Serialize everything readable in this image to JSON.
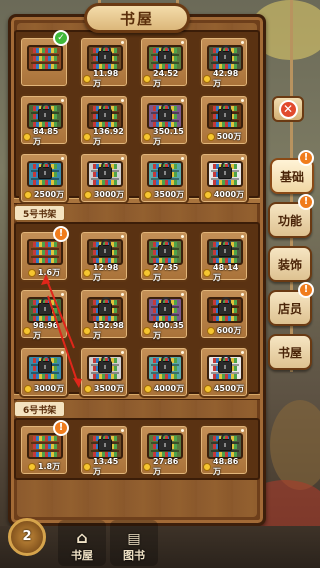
{
  "title": "书屋",
  "sections": [
    {
      "label": "",
      "items": [
        {
          "price": "",
          "locked": false,
          "owned": true,
          "alert": false,
          "color": "#8a4a24"
        },
        {
          "price": "11.98万",
          "locked": true,
          "owned": false,
          "alert": false,
          "color": "#6b4a26"
        },
        {
          "price": "24.52万",
          "locked": true,
          "owned": false,
          "alert": false,
          "color": "#5a7a3e"
        },
        {
          "price": "42.98万",
          "locked": true,
          "owned": false,
          "alert": false,
          "color": "#4e5a42"
        },
        {
          "price": "84.85万",
          "locked": true,
          "owned": false,
          "alert": false,
          "color": "#4a6a3a"
        },
        {
          "price": "136.92万",
          "locked": true,
          "owned": false,
          "alert": false,
          "color": "#6a4020"
        },
        {
          "price": "350.15万",
          "locked": true,
          "owned": false,
          "alert": false,
          "color": "#7a5a8a"
        },
        {
          "price": "500万",
          "locked": true,
          "owned": false,
          "alert": false,
          "color": "#6a3a18"
        },
        {
          "price": "2500万",
          "locked": true,
          "owned": false,
          "alert": false,
          "color": "#3a8aa8"
        },
        {
          "price": "3000万",
          "locked": true,
          "owned": false,
          "alert": false,
          "color": "#cfcfcf"
        },
        {
          "price": "3500万",
          "locked": true,
          "owned": false,
          "alert": false,
          "color": "#5aa8a8"
        },
        {
          "price": "4000万",
          "locked": true,
          "owned": false,
          "alert": false,
          "color": "#e8e8e8"
        }
      ]
    },
    {
      "label": "5号书架",
      "items": [
        {
          "price": "1.6万",
          "locked": false,
          "owned": false,
          "alert": true,
          "color": "#8a4a24"
        },
        {
          "price": "12.98万",
          "locked": true,
          "owned": false,
          "alert": false,
          "color": "#6b4a26"
        },
        {
          "price": "27.35万",
          "locked": true,
          "owned": false,
          "alert": false,
          "color": "#5a7a3e"
        },
        {
          "price": "48.14万",
          "locked": true,
          "owned": false,
          "alert": false,
          "color": "#4e5a42"
        },
        {
          "price": "98.96万",
          "locked": true,
          "owned": false,
          "alert": false,
          "color": "#4a6a3a"
        },
        {
          "price": "152.98万",
          "locked": true,
          "owned": false,
          "alert": false,
          "color": "#6a4020"
        },
        {
          "price": "400.35万",
          "locked": true,
          "owned": false,
          "alert": false,
          "color": "#7a5a8a"
        },
        {
          "price": "600万",
          "locked": true,
          "owned": false,
          "alert": false,
          "color": "#6a3a18"
        },
        {
          "price": "3000万",
          "locked": true,
          "owned": false,
          "alert": false,
          "color": "#3a8aa8"
        },
        {
          "price": "3500万",
          "locked": true,
          "owned": false,
          "alert": false,
          "color": "#cfcfcf"
        },
        {
          "price": "4000万",
          "locked": true,
          "owned": false,
          "alert": false,
          "color": "#5aa8a8"
        },
        {
          "price": "4500万",
          "locked": true,
          "owned": false,
          "alert": false,
          "color": "#e8e8e8"
        }
      ]
    },
    {
      "label": "6号书架",
      "items": [
        {
          "price": "1.8万",
          "locked": false,
          "owned": false,
          "alert": true,
          "color": "#8a4a24"
        },
        {
          "price": "13.45万",
          "locked": true,
          "owned": false,
          "alert": false,
          "color": "#6b4a26"
        },
        {
          "price": "27.86万",
          "locked": true,
          "owned": false,
          "alert": false,
          "color": "#5a7a3e"
        },
        {
          "price": "48.86万",
          "locked": true,
          "owned": false,
          "alert": false,
          "color": "#4e5a42"
        }
      ]
    }
  ],
  "side_tabs": [
    {
      "label": "基础",
      "active": true,
      "alert": true
    },
    {
      "label": "功能",
      "active": false,
      "alert": true
    },
    {
      "label": "装饰",
      "active": false,
      "alert": false
    },
    {
      "label": "店员",
      "active": false,
      "alert": true
    },
    {
      "label": "书屋",
      "active": false,
      "alert": false
    }
  ],
  "bottom_nav": [
    {
      "label": "书屋",
      "icon": "house-icon"
    },
    {
      "label": "图书",
      "icon": "book-icon"
    }
  ],
  "level_badge": "2",
  "icons": {
    "close": "close-icon",
    "check": "check-icon",
    "alert": "exclamation-icon",
    "lock": "lock-icon",
    "coin": "coin-icon"
  },
  "colors": {
    "alert": "#f07c1c",
    "check": "#3fb83a",
    "close": "#e14a2d",
    "coin": "#f6c630",
    "arrow": "#e0261a"
  }
}
